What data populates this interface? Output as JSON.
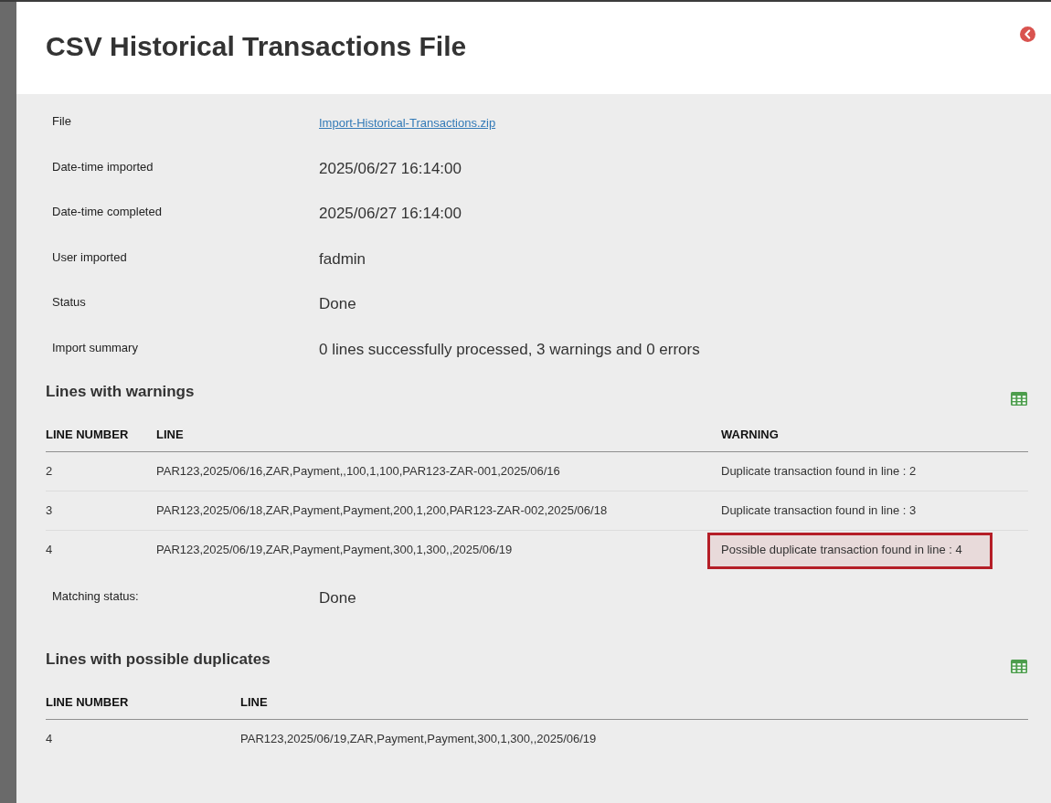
{
  "dialog": {
    "title": "CSV Historical Transactions File"
  },
  "details": [
    {
      "label": "File",
      "value": "Import-Historical-Transactions.zip",
      "kind": "link"
    },
    {
      "label": "Date-time imported",
      "value": "2025/06/27 16:14:00",
      "kind": "text"
    },
    {
      "label": "Date-time completed",
      "value": "2025/06/27 16:14:00",
      "kind": "text"
    },
    {
      "label": "User imported",
      "value": "fadmin",
      "kind": "text"
    },
    {
      "label": "Status",
      "value": "Done",
      "kind": "text"
    },
    {
      "label": "Import summary",
      "value": "0 lines successfully processed, 3 warnings and 0 errors",
      "kind": "text"
    }
  ],
  "warnings": {
    "title": "Lines with warnings",
    "columns": [
      "LINE NUMBER",
      "LINE",
      "WARNING"
    ],
    "rows": [
      {
        "line_number": "2",
        "line": "PAR123,2025/06/16,ZAR,Payment,,100,1,100,PAR123-ZAR-001,2025/06/16",
        "warning": "Duplicate transaction found in line : 2",
        "highlighted": false
      },
      {
        "line_number": "3",
        "line": "PAR123,2025/06/18,ZAR,Payment,Payment,200,1,200,PAR123-ZAR-002,2025/06/18",
        "warning": "Duplicate transaction found in line : 3",
        "highlighted": false
      },
      {
        "line_number": "4",
        "line": "PAR123,2025/06/19,ZAR,Payment,Payment,300,1,300,,2025/06/19",
        "warning": "Possible duplicate transaction found in line : 4",
        "highlighted": true
      }
    ]
  },
  "matching_status": {
    "label": "Matching status:",
    "value": "Done"
  },
  "duplicates": {
    "title": "Lines with possible duplicates",
    "columns": [
      "LINE NUMBER",
      "LINE"
    ],
    "rows": [
      {
        "line_number": "4",
        "line": "PAR123,2025/06/19,ZAR,Payment,Payment,300,1,300,,2025/06/19"
      }
    ]
  }
}
